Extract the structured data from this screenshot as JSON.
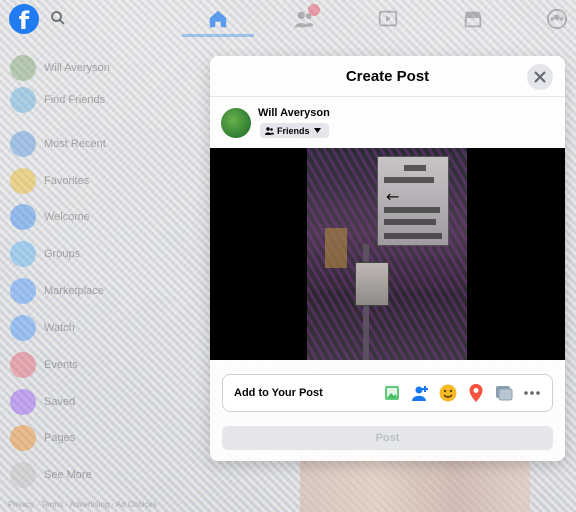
{
  "topbar": {
    "logo_glyph": "f",
    "icons": [
      "facebook-logo",
      "search-icon",
      "home-icon",
      "friends-icon",
      "watch-icon",
      "marketplace-icon",
      "groups-icon"
    ]
  },
  "sidebar": {
    "items": [
      {
        "label": "Will Averyson",
        "icon": "avatar",
        "color": "#6a9a5a"
      },
      {
        "label": "Find Friends",
        "icon": "friends-icon",
        "color": "#4aa3df"
      },
      {
        "label": "Most Recent",
        "icon": "clock-icon",
        "color": "#3b87e0"
      },
      {
        "label": "Favorites",
        "icon": "star-icon",
        "color": "#f0b400"
      },
      {
        "label": "Welcome",
        "icon": "facebook-icon",
        "color": "#1877f2"
      },
      {
        "label": "Groups",
        "icon": "groups-icon",
        "color": "#3fa9f5"
      },
      {
        "label": "Marketplace",
        "icon": "shop-icon",
        "color": "#2d88ff"
      },
      {
        "label": "Watch",
        "icon": "watch-icon",
        "color": "#2d88ff"
      },
      {
        "label": "Events",
        "icon": "calendar-icon",
        "color": "#e84a5f"
      },
      {
        "label": "Saved",
        "icon": "bookmark-icon",
        "color": "#8a3ffc"
      },
      {
        "label": "Pages",
        "icon": "flag-icon",
        "color": "#f57c00"
      },
      {
        "label": "See More",
        "icon": "chevron-down-icon",
        "color": "#bbbbbb"
      }
    ],
    "footer": "Privacy · Terms · Advertising · Ad Choices"
  },
  "modal": {
    "title": "Create Post",
    "author": "Will Averyson",
    "audience": "Friends",
    "add_to_post_label": "Add to Your Post",
    "post_button": "Post",
    "add_icons": [
      "photo-video-icon",
      "tag-people-icon",
      "feeling-icon",
      "check-in-icon",
      "gif-icon",
      "more-icon"
    ],
    "photo_sign_text": [
      "W",
      "STREET",
      "ONE WAY",
      "WALK SIGNAL"
    ]
  },
  "colors": {
    "brand": "#1877f2",
    "accent_red": "#e84a5f",
    "button_gray": "#e4e6eb"
  }
}
